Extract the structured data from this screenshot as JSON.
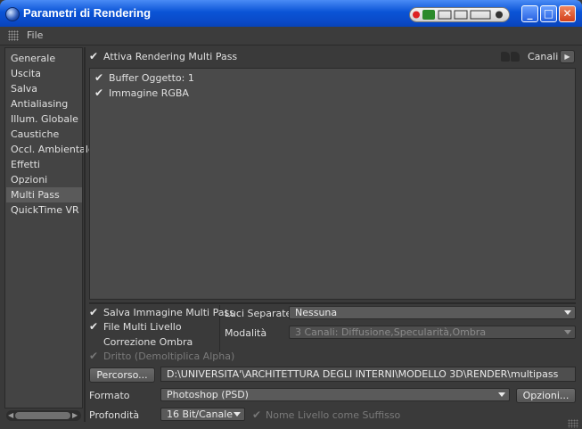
{
  "window": {
    "title": "Parametri di Rendering",
    "minimize_glyph": "_",
    "maximize_glyph": "□",
    "close_glyph": "✕"
  },
  "menu": {
    "file": "File"
  },
  "sidebar": {
    "items": [
      "Generale",
      "Uscita",
      "Salva",
      "Antialiasing",
      "Illum. Globale",
      "Caustiche",
      "Occl. Ambientale",
      "Effetti",
      "Opzioni",
      "Multi Pass",
      "QuickTime VR"
    ],
    "selected": "Multi Pass"
  },
  "multipass": {
    "enable_label": "Attiva Rendering Multi Pass",
    "channels_label": "Canali",
    "channels": [
      "Buffer Oggetto: 1",
      "Immagine RGBA"
    ]
  },
  "options": {
    "save_image": "Salva Immagine Multi Pass",
    "multilayer_file": "File Multi Livello",
    "shadow_correction": "Correzione Ombra",
    "straight": "Dritto (Demoltiplica Alpha)",
    "separate_lights_label": "Luci Separate",
    "separate_lights_value": "Nessuna",
    "mode_label": "Modalità",
    "mode_value": "3 Canali: Diffusione,Specularità,Ombra"
  },
  "path": {
    "button": "Percorso...",
    "value": "D:\\UNIVERSITA'\\ARCHITETTURA DEGLI INTERNI\\MODELLO 3D\\RENDER\\multipass"
  },
  "format": {
    "label": "Formato",
    "value": "Photoshop (PSD)",
    "options_button": "Opzioni..."
  },
  "depth": {
    "label": "Profondità",
    "value": "16 Bit/Canale",
    "suffix_label": "Nome Livello come Suffisso"
  },
  "check_glyph": "✔",
  "colors": {
    "titlebar": "#0a54d6",
    "background": "#3a3a3a",
    "selection": "#5a5a5a"
  }
}
